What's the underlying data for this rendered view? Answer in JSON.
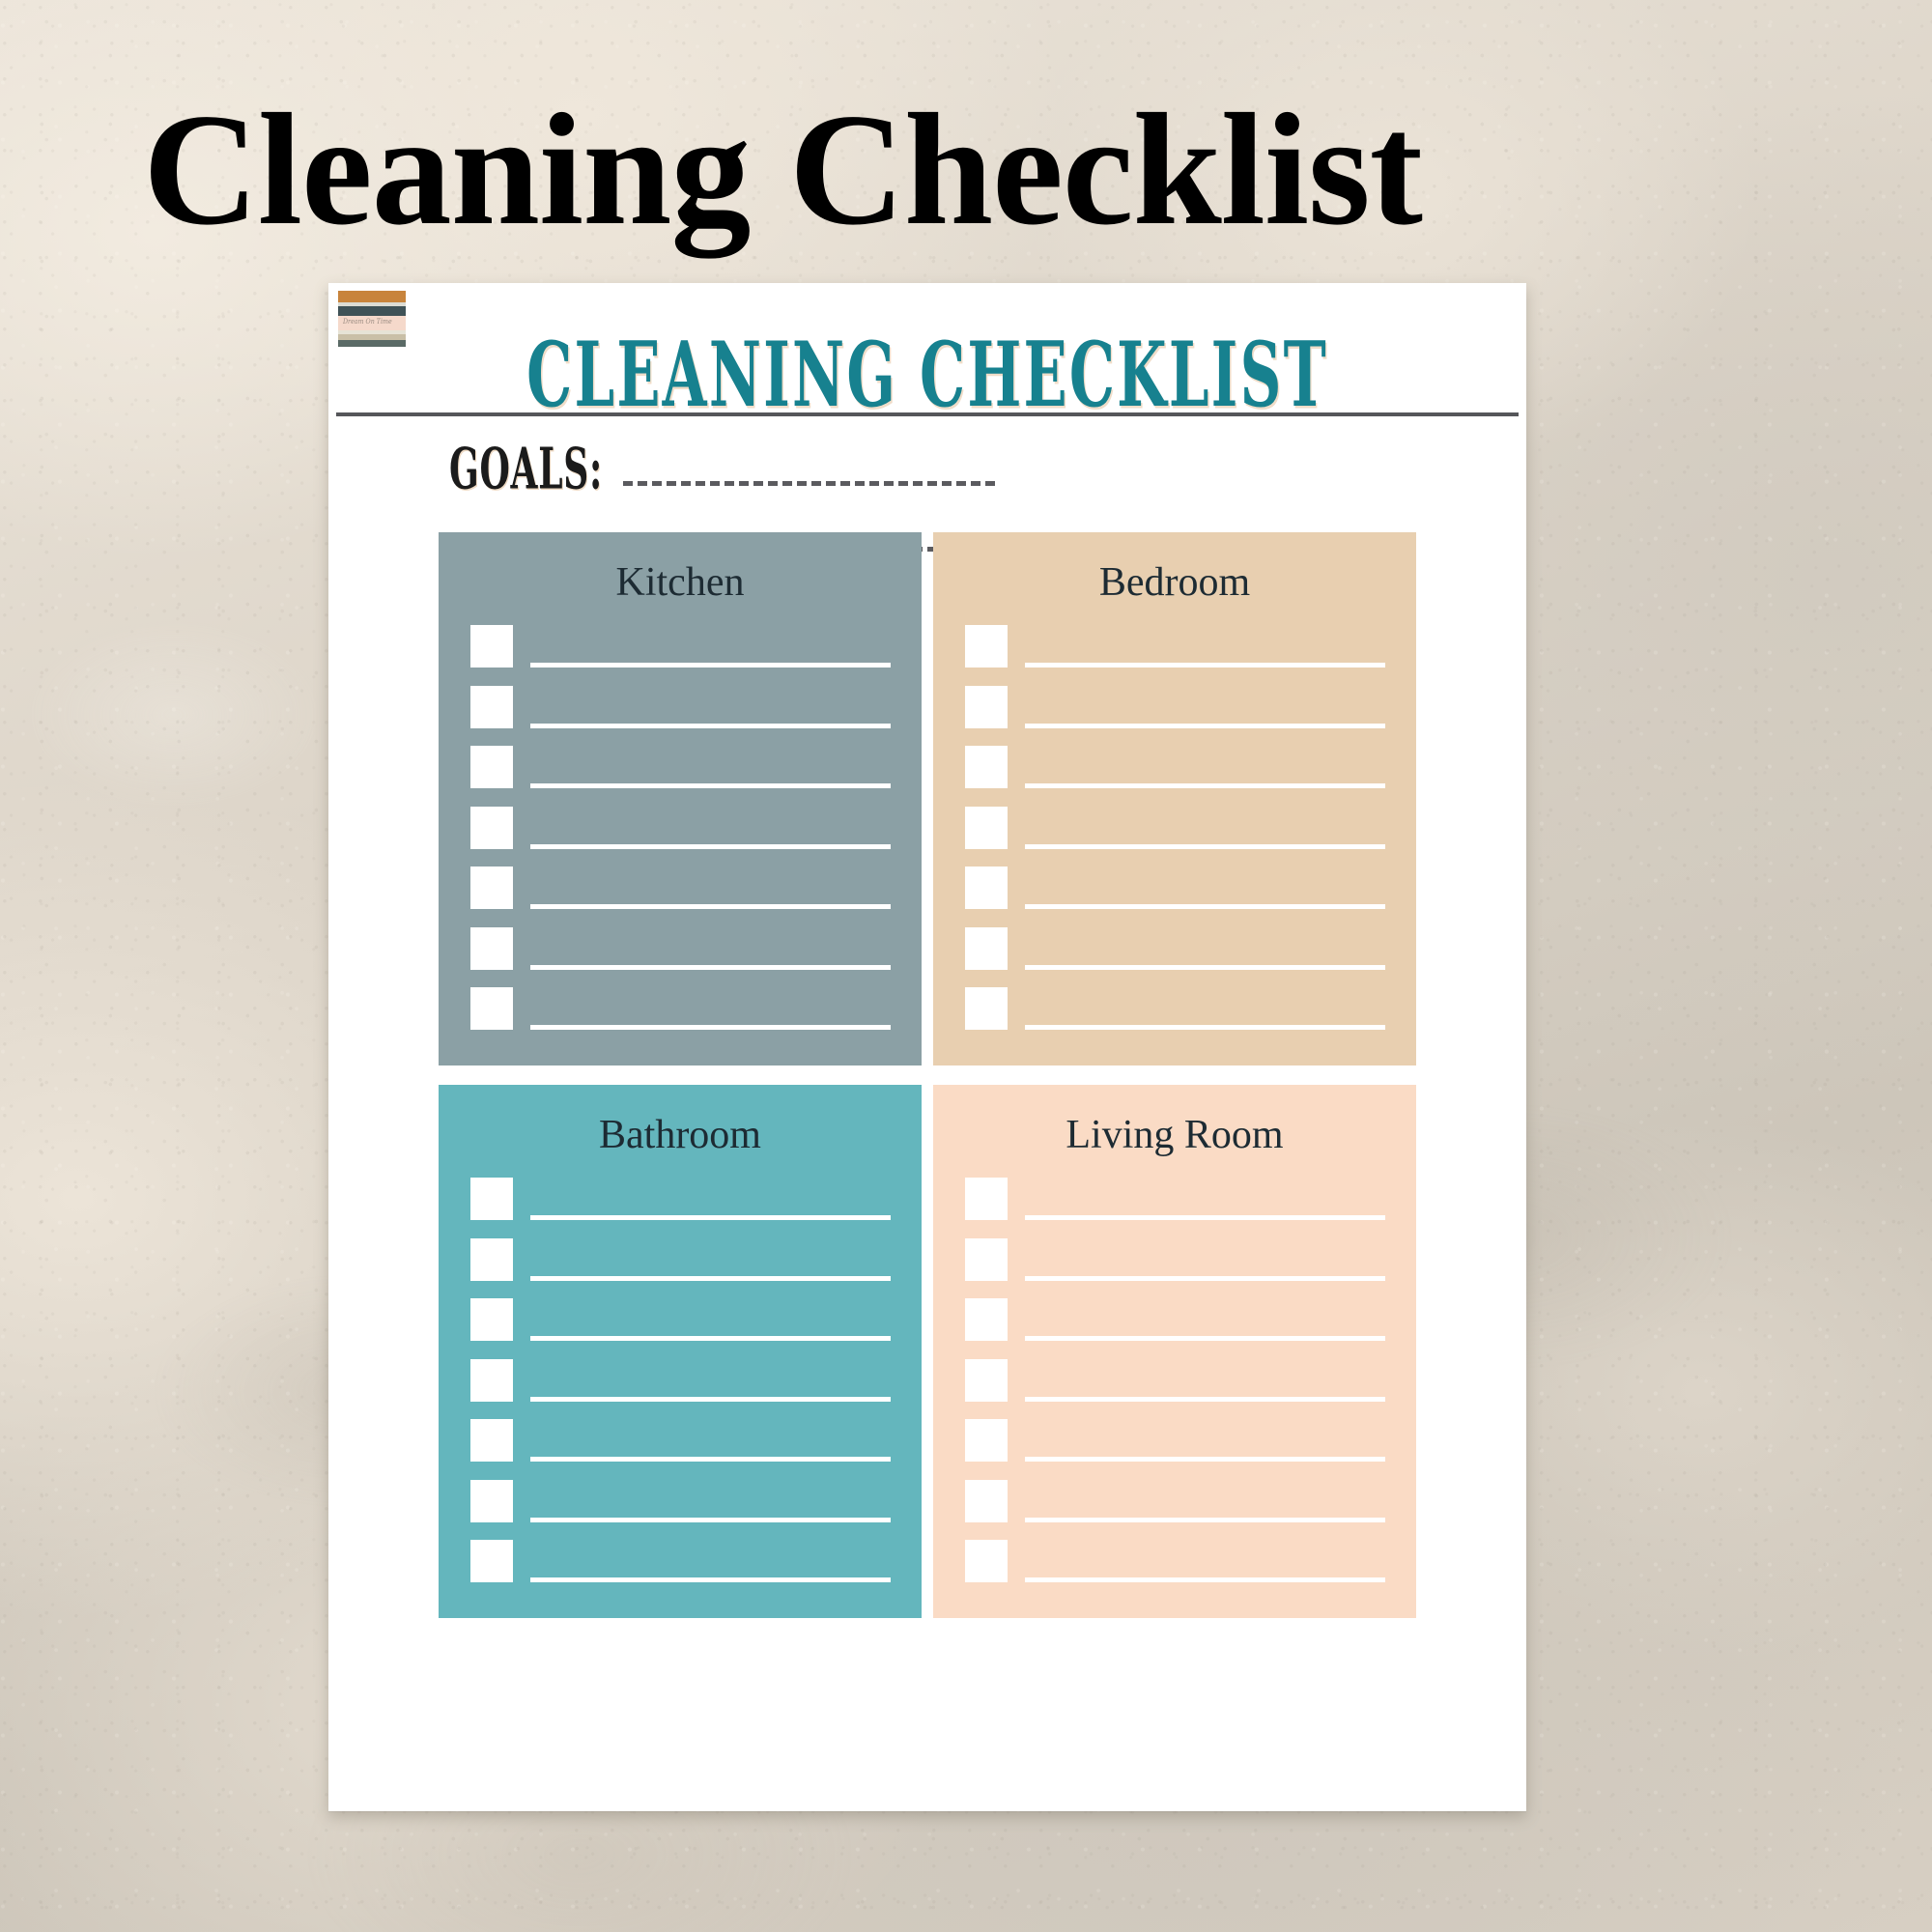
{
  "page": {
    "heading": "Cleaning Checklist",
    "background_color": "#d8d1c6"
  },
  "sheet": {
    "title": "CLEANING CHECKLIST",
    "title_color": "#17818f",
    "background_color": "#ffffff",
    "logo": {
      "name": "striped-brand-logo",
      "script_text": "Dream On Time",
      "stripe_colors": [
        "#c8843c",
        "#dcdcd4",
        "#3f5257",
        "#f5d9cb",
        "#e6e3d6",
        "#c9bfa7",
        "#5a6a66"
      ]
    },
    "goals": {
      "label": "GOALS:",
      "line_count": 2,
      "line_style": "dashed",
      "line_color": "#5b5b5f"
    },
    "cards": [
      {
        "title": "Kitchen",
        "color": "#8ba0a5",
        "row_count": 7,
        "checkbox_color": "#ffffff",
        "line_color": "#ffffff"
      },
      {
        "title": "Bedroom",
        "color": "#e8cfb0",
        "row_count": 7,
        "checkbox_color": "#ffffff",
        "line_color": "#ffffff"
      },
      {
        "title": "Bathroom",
        "color": "#64b6bd",
        "row_count": 7,
        "checkbox_color": "#ffffff",
        "line_color": "#ffffff"
      },
      {
        "title": "Living Room",
        "color": "#fadbc5",
        "row_count": 7,
        "checkbox_color": "#ffffff",
        "line_color": "#ffffff"
      }
    ]
  }
}
